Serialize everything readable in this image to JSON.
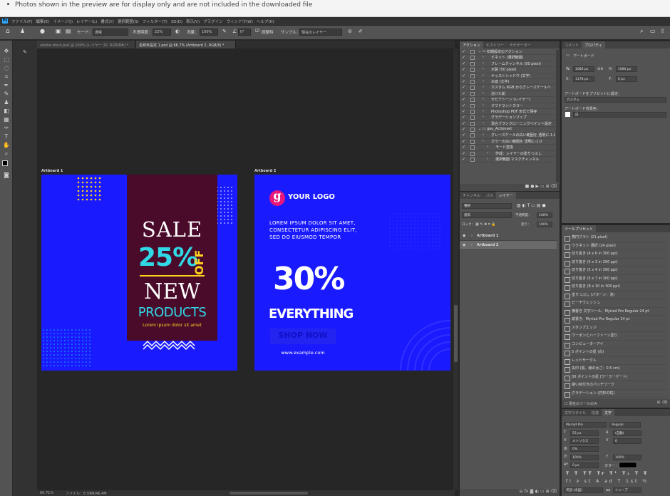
{
  "notice": "Photos shown in the preview are for display only and are not included in the downloaded file",
  "app_logo": "Ps",
  "menu": [
    "ファイル(F)",
    "編集(E)",
    "イメージ(I)",
    "レイヤー(L)",
    "書式(Y)",
    "選択範囲(S)",
    "フィルター(T)",
    "3D(D)",
    "表示(V)",
    "プラグイン",
    "ウィンドウ(W)",
    "ヘルプ(H)"
  ],
  "options": {
    "mode_label": "モード：",
    "mode_value": "通常",
    "opacity_label": "不透明度：",
    "opacity_value": "22%",
    "flow_label": "流量：",
    "flow_value": "100%",
    "angle_value": "0°",
    "align_label": "調整時",
    "sample_label": "サンプル：",
    "sample_value": "現在のレイヤー"
  },
  "doc_tabs": [
    {
      "label": "adobe-stock.psd @ 100% (レイヤー 32, RGB/8#) *"
    },
    {
      "label": "名称未設定 1.psd @ 66.7% (Artboard 2, RGB/8) *"
    }
  ],
  "artboard1": {
    "label": "Artboard 1",
    "sale": "SALE",
    "percent": "25%",
    "off": "OFF",
    "new": "NEW",
    "products": "PRODUCTS",
    "lorem": "Lorem ipsum dolor sit amet"
  },
  "artboard2": {
    "label": "Artboard 2",
    "logo_letter": "g",
    "logo_text": "YOUR LOGO",
    "lorem": "LOREM IPSUM DOLOR SIT AMET, CONSECTETUR ADIPISCING ELIT, SED DO EIUSMOD TEMPOR",
    "percent": "30%",
    "everything": "EVERYTHING",
    "shop_now": "SHOP NOW",
    "url": "www.example.com"
  },
  "status": {
    "zoom": "66.71%",
    "doc": "ファイル：6.59M/46.4M"
  },
  "actions_panel": {
    "tabs": [
      "アクション",
      "ヒストリー",
      "ナビゲーター"
    ],
    "rows": [
      "初期設定のアクション",
      "ビネット (選択範囲)",
      "フレームチャンネル (50 pixel)",
      "木製 (50 pixel)",
      "キャストシャドウ (文字)",
      "水面 (文字)",
      "カスタム RGB からグレースケールへ",
      "溶けた鉛",
      "セピアトーン (レイヤー)",
      "クワドラントカラー",
      "Photoshop PDF 形式で保存",
      "グラデーションマップ",
      "混合ブラシクローニングペイント設定",
      "gau_Actionset",
      "グレースケールの白い範囲を 透明に-1.0",
      "カラーの白い範囲を 透明に-1.0",
      "モード変換",
      "作成：レイヤーの塗りつぶし",
      "選択範囲 マスクチャンネル"
    ]
  },
  "properties_panel": {
    "tabs": [
      "コメント",
      "プロパティ"
    ],
    "title": "アートボード",
    "w_label": "W:",
    "w_value": "1080 px",
    "h_label": "H:",
    "h_value": "1080 px",
    "x_label": "X:",
    "x_value": "1178 px",
    "y_label": "Y:",
    "y_value": "0 px",
    "preset_label": "アートボードをプリセットに設定：",
    "preset_value": "カスタム",
    "bg_label": "アートボード背景色：",
    "bg_value": "白"
  },
  "layers_panel": {
    "tabs": [
      "チャンネル",
      "パス",
      "レイヤー"
    ],
    "search": "種類",
    "blend": "通常",
    "opacity_label": "不透明度：",
    "opacity_value": "100%",
    "lock_label": "ロック：",
    "fill_label": "塗り：",
    "fill_value": "100%",
    "layers": [
      "Artboard 1",
      "Artboard 2"
    ]
  },
  "tool_presets": {
    "title": "ツールプリセット",
    "items": [
      "楕円ブラシ (21 pixel)",
      "ウクネット 選択 (24 pixel)",
      "切り抜き (4 x 6 in 300 ppi)",
      "切り抜き (5 x 3 in 300 ppi)",
      "切り抜き (5 x 4 in 300 ppi)",
      "切り抜き (5 x 7 in 300 ppi)",
      "切り抜き (8 x 10 in 300 ppi)",
      "塗りつぶし (パターン：泡)",
      "ビーチウェッシュ",
      "横書き 文字ツール、Myriad Pro Regular 24 pt",
      "縦書き、Myriad Pro Regular 24 pt",
      "スタンプエッジ",
      "ウーポンとハーフトーン塗り",
      "コンピューターアイ",
      "5 ポイントの星 (白)",
      "レッドサークル",
      "矢印 (黒、線の太さ：0.5 cm)",
      "30 ポイントの星 (ウーラーゲート)",
      "縁い目付きのパッチワーク",
      "グラデーション (円形の虹)"
    ],
    "footer": "現在のツールのみ"
  },
  "character_panel": {
    "tabs": [
      "文字スタイル",
      "段落",
      "文字"
    ],
    "font": "Myriad Pro",
    "style": "Regular",
    "size": "55 px",
    "leading": "(自動)",
    "kerning": "メトリクス",
    "tracking": "0",
    "vscale": "0%",
    "hscale_v": "100%",
    "hscale_h": "100%",
    "baseline": "0 px",
    "color_label": "カラー：",
    "lang": "英語 (米国)",
    "aa": "シャープ"
  }
}
